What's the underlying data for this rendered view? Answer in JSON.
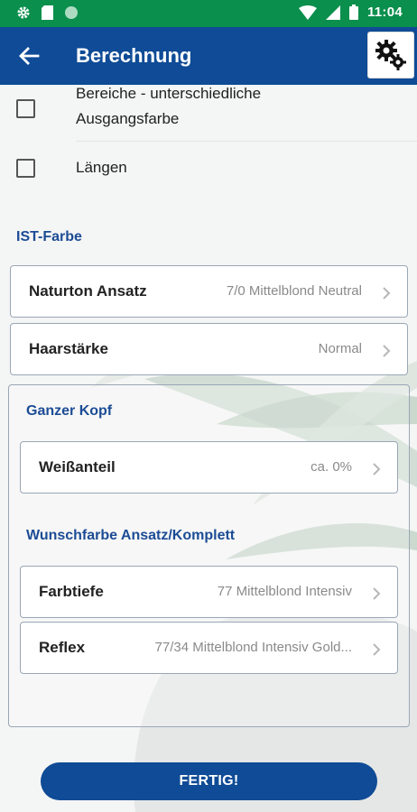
{
  "status_bar": {
    "time": "11:04",
    "left_icons": [
      "gear-icon",
      "sd-card-icon",
      "circle-icon"
    ],
    "right_icons": [
      "wifi-icon",
      "signal-icon",
      "battery-icon"
    ]
  },
  "app_bar": {
    "title": "Berechnung",
    "back_icon": "arrow-left-icon",
    "settings_icon": "gears-icon"
  },
  "checkboxes": [
    {
      "label_line1": "Bereiche - unterschiedliche",
      "label_line2": "Ausgangsfarbe",
      "checked": false
    },
    {
      "label": "Längen",
      "checked": false
    }
  ],
  "ist_farbe": {
    "heading": "IST-Farbe",
    "rows": [
      {
        "label": "Naturton Ansatz",
        "value": "7/0 Mittelblond Neutral"
      },
      {
        "label": "Haarstärke",
        "value": "Normal"
      }
    ]
  },
  "ganzer_kopf": {
    "heading": "Ganzer Kopf",
    "rows": [
      {
        "label": "Weißanteil",
        "value": "ca. 0%"
      }
    ]
  },
  "wunschfarbe": {
    "heading": "Wunschfarbe Ansatz/Komplett",
    "rows": [
      {
        "label": "Farbtiefe",
        "value": "77 Mittelblond Intensiv"
      },
      {
        "label": "Reflex",
        "value": "77/34 Mittelblond Intensiv Gold..."
      }
    ]
  },
  "actions": {
    "done_label": "FERTIG!"
  },
  "colors": {
    "status_bar": "#0a8f4c",
    "app_bar": "#0f4b96",
    "section_heading": "#1c4c95",
    "button": "#0f4b96"
  }
}
